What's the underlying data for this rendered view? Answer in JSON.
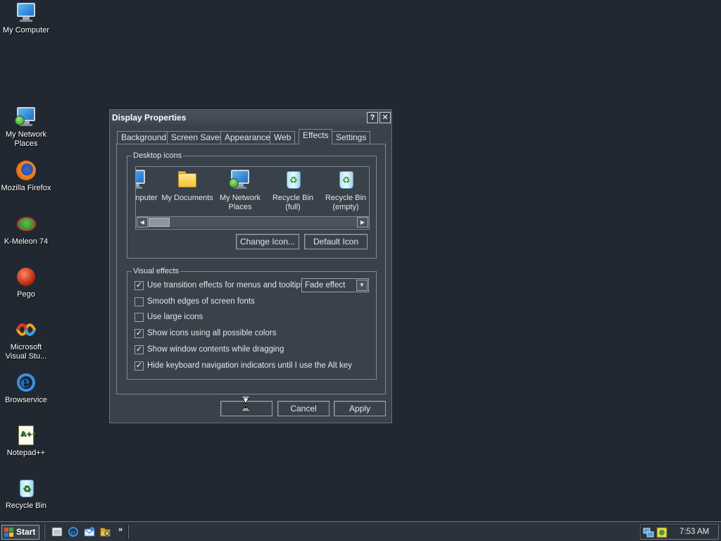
{
  "desktop": {
    "icons": [
      {
        "label": "My Computer",
        "icon": "my-computer-icon"
      },
      {
        "label": "My Network Places",
        "icon": "network-places-icon"
      },
      {
        "label": "Mozilla Firefox",
        "icon": "firefox-icon"
      },
      {
        "label": "K-Meleon 74",
        "icon": "k-meleon-icon"
      },
      {
        "label": "Pego",
        "icon": "pego-icon"
      },
      {
        "label": "Microsoft Visual Stu...",
        "icon": "visual-studio-icon"
      },
      {
        "label": "Browservice",
        "icon": "internet-explorer-icon"
      },
      {
        "label": "Notepad++",
        "icon": "notepad-plus-plus-icon"
      },
      {
        "label": "Recycle Bin",
        "icon": "recycle-bin-icon"
      }
    ]
  },
  "dialog": {
    "title": "Display Properties",
    "help_button": "?",
    "close_button": "✕",
    "tabs": [
      {
        "label": "Background"
      },
      {
        "label": "Screen Saver"
      },
      {
        "label": "Appearance"
      },
      {
        "label": "Web"
      },
      {
        "label": "Effects",
        "active": true
      },
      {
        "label": "Settings"
      }
    ],
    "desktop_icons": {
      "legend": "Desktop icons",
      "items": [
        {
          "label": "nputer",
          "icon": "my-computer-icon"
        },
        {
          "label": "My Documents",
          "icon": "my-documents-icon"
        },
        {
          "label": "My Network Places",
          "icon": "network-places-icon"
        },
        {
          "label": "Recycle Bin (full)",
          "icon": "recycle-bin-full-icon"
        },
        {
          "label": "Recycle Bin (empty)",
          "icon": "recycle-bin-empty-icon"
        }
      ],
      "change_icon_button": "Change Icon...",
      "default_icon_button": "Default Icon"
    },
    "visual_effects": {
      "legend": "Visual effects",
      "transition_effect_select": "Fade effect",
      "options": [
        {
          "label": "Use transition effects for menus and tooltips",
          "checked": true
        },
        {
          "label": "Smooth edges of screen fonts",
          "checked": false
        },
        {
          "label": "Use large icons",
          "checked": false
        },
        {
          "label": "Show icons using all possible colors",
          "checked": true
        },
        {
          "label": "Show window contents while dragging",
          "checked": true
        },
        {
          "label": "Hide keyboard navigation indicators until I use the Alt key",
          "checked": true
        }
      ]
    },
    "buttons": {
      "ok": "",
      "cancel": "Cancel",
      "apply": "Apply"
    }
  },
  "taskbar": {
    "start_label": "Start",
    "quick_launch": [
      "show-desktop-icon",
      "internet-explorer-icon",
      "outlook-express-icon",
      "explorer-icon"
    ],
    "quick_launch_more": "»",
    "tray_icons": [
      "network-tray-icon",
      "app-tray-icon"
    ],
    "clock": "7:53 AM"
  },
  "colors": {
    "desktop_background": "#222831",
    "dialog_background": "#39414b",
    "border": "#7f8894",
    "text": "#e6e6e6"
  }
}
